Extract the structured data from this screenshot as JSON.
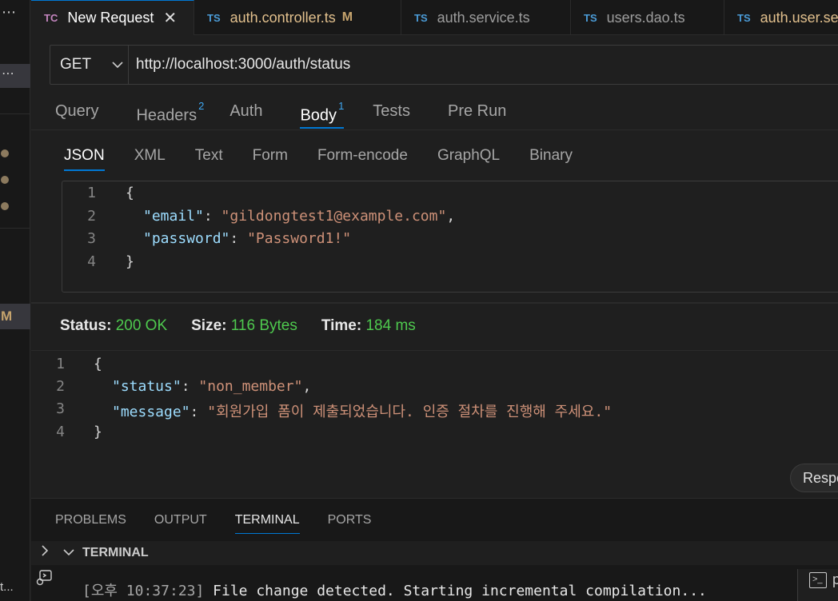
{
  "sidebar": {
    "top_dots": "⋯",
    "sel_dots": "⋯",
    "modified_marker": "M",
    "bottom_text": "t..."
  },
  "tabs": [
    {
      "icon": "TC",
      "label": "New Request",
      "active": true,
      "close": "✕"
    },
    {
      "icon": "TS",
      "label": "auth.controller.ts",
      "modified": "M"
    },
    {
      "icon": "TS",
      "label": "auth.service.ts"
    },
    {
      "icon": "TS",
      "label": "users.dao.ts"
    },
    {
      "icon": "TS",
      "label": "auth.user.se"
    }
  ],
  "request": {
    "method": "GET",
    "url": "http://localhost:3000/auth/status",
    "tabs": [
      {
        "label": "Query"
      },
      {
        "label": "Headers",
        "badge": "2"
      },
      {
        "label": "Auth"
      },
      {
        "label": "Body",
        "badge": "1",
        "active": true
      },
      {
        "label": "Tests"
      },
      {
        "label": "Pre Run"
      }
    ],
    "body_tabs": [
      "JSON",
      "XML",
      "Text",
      "Form",
      "Form-encode",
      "GraphQL",
      "Binary"
    ],
    "body_lines": [
      {
        "n": "1",
        "text": "{"
      },
      {
        "n": "2",
        "key": "\"email\"",
        "sep": ": ",
        "val": "\"gildongtest1@example.com\"",
        "end": ","
      },
      {
        "n": "3",
        "key": "\"password\"",
        "sep": ": ",
        "val": "\"Password1!\"",
        "end": ""
      },
      {
        "n": "4",
        "text": "}"
      }
    ]
  },
  "response": {
    "status_label": "Status:",
    "status": "200 OK",
    "size_label": "Size:",
    "size": "116 Bytes",
    "time_label": "Time:",
    "time": "184 ms",
    "lines": [
      {
        "n": "1",
        "text": "{"
      },
      {
        "n": "2",
        "key": "\"status\"",
        "sep": ": ",
        "val": "\"non_member\"",
        "end": ","
      },
      {
        "n": "3",
        "key": "\"message\"",
        "sep": ": ",
        "val": "\"회원가입 폼이 제출되었습니다. 인증 절차를 진행해 주세요.\"",
        "end": ""
      },
      {
        "n": "4",
        "text": "}"
      }
    ],
    "button_label": "Respo"
  },
  "panel": {
    "tabs": [
      "PROBLEMS",
      "OUTPUT",
      "TERMINAL",
      "PORTS"
    ],
    "active_tab": "TERMINAL",
    "section_title": "TERMINAL",
    "line_ts": "[오후 10:37:23]",
    "line_msg": " File change detected. Starting incremental compilation...",
    "right_label": "p"
  },
  "colors": {
    "accent": "#0078d4",
    "ok": "#4ec94e",
    "json_key": "#9cdcfe",
    "json_string": "#ce9178",
    "badge": "#3ea7f2"
  }
}
